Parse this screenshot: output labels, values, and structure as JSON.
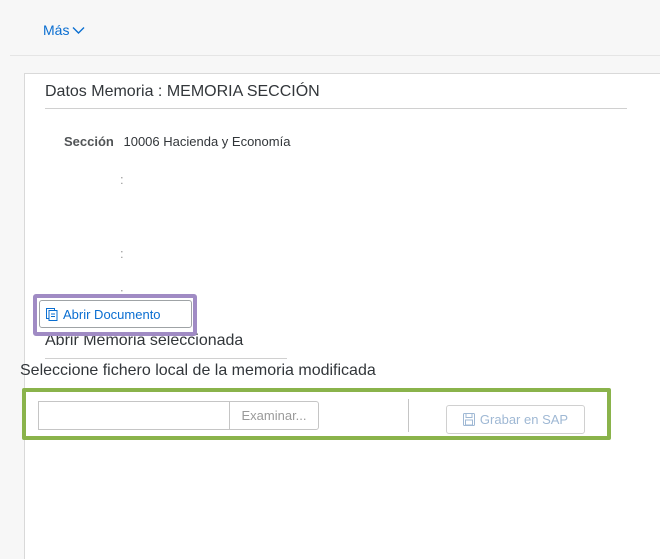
{
  "toolbar": {
    "more_label": "Más"
  },
  "memoria": {
    "title": "Datos Memoria : MEMORIA SECCIÓN",
    "section_label": "Sección",
    "section_value": "10006 Hacienda y Economía",
    "empty_field_colon": ":"
  },
  "open_section": {
    "title": "Abrir Memoria seleccionada",
    "open_button_label": "Abrir Documento"
  },
  "upload_section": {
    "title": "Seleccione fichero local de la memoria modificada",
    "file_value": "",
    "browse_label": "Examinar...",
    "save_button_label": "Grabar en SAP"
  },
  "colors": {
    "accent": "#0a6ed1",
    "highlight_purple": "#a08bc4",
    "highlight_green": "#8ab34b"
  }
}
